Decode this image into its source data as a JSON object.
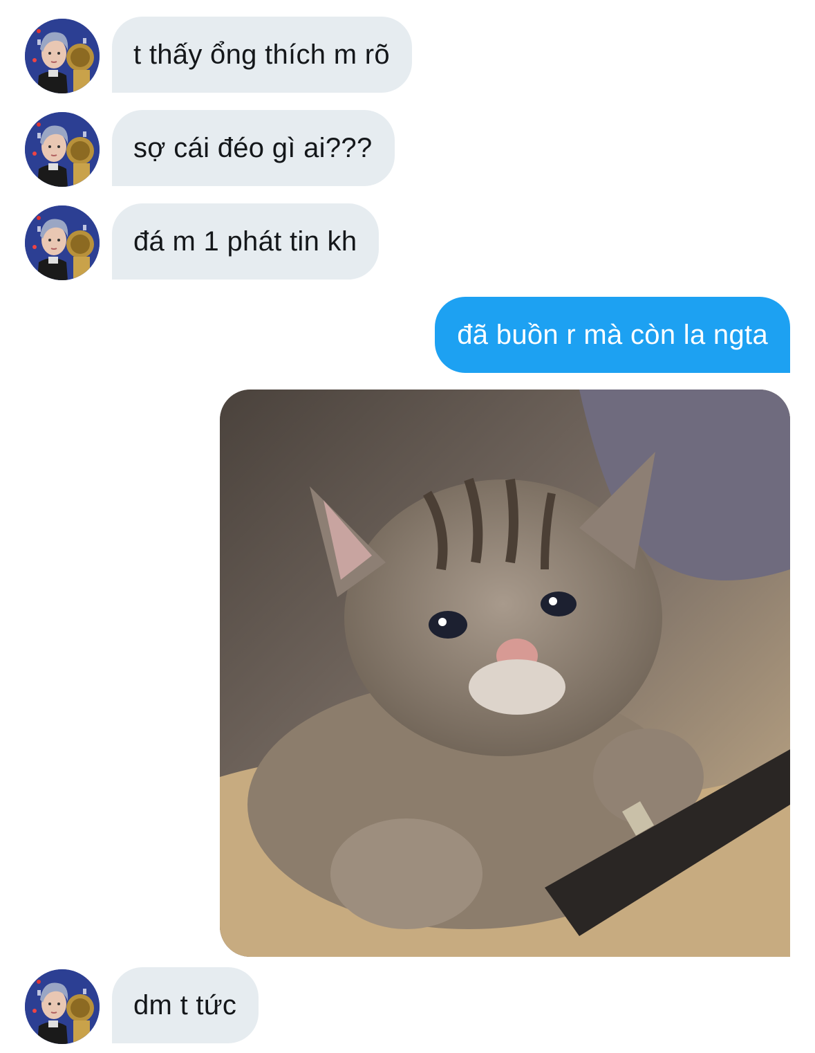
{
  "conversation": {
    "messages": [
      {
        "direction": "incoming",
        "text": "t thấy ổng thích m rõ",
        "avatar": "user-avatar"
      },
      {
        "direction": "incoming",
        "text": "sợ cái đéo gì ai???",
        "avatar": "user-avatar"
      },
      {
        "direction": "incoming",
        "text": "đá m 1 phát tin kh",
        "avatar": "user-avatar"
      },
      {
        "direction": "outgoing",
        "text": "đã buồn r mà còn la ngta"
      },
      {
        "direction": "outgoing",
        "type": "image",
        "image": "crying-cat-meme"
      },
      {
        "direction": "incoming",
        "text": "dm t tức",
        "avatar": "user-avatar"
      }
    ]
  },
  "colors": {
    "incoming_bubble": "#e6ecf0",
    "incoming_text": "#14171a",
    "outgoing_bubble": "#1da1f2",
    "outgoing_text": "#ffffff"
  }
}
